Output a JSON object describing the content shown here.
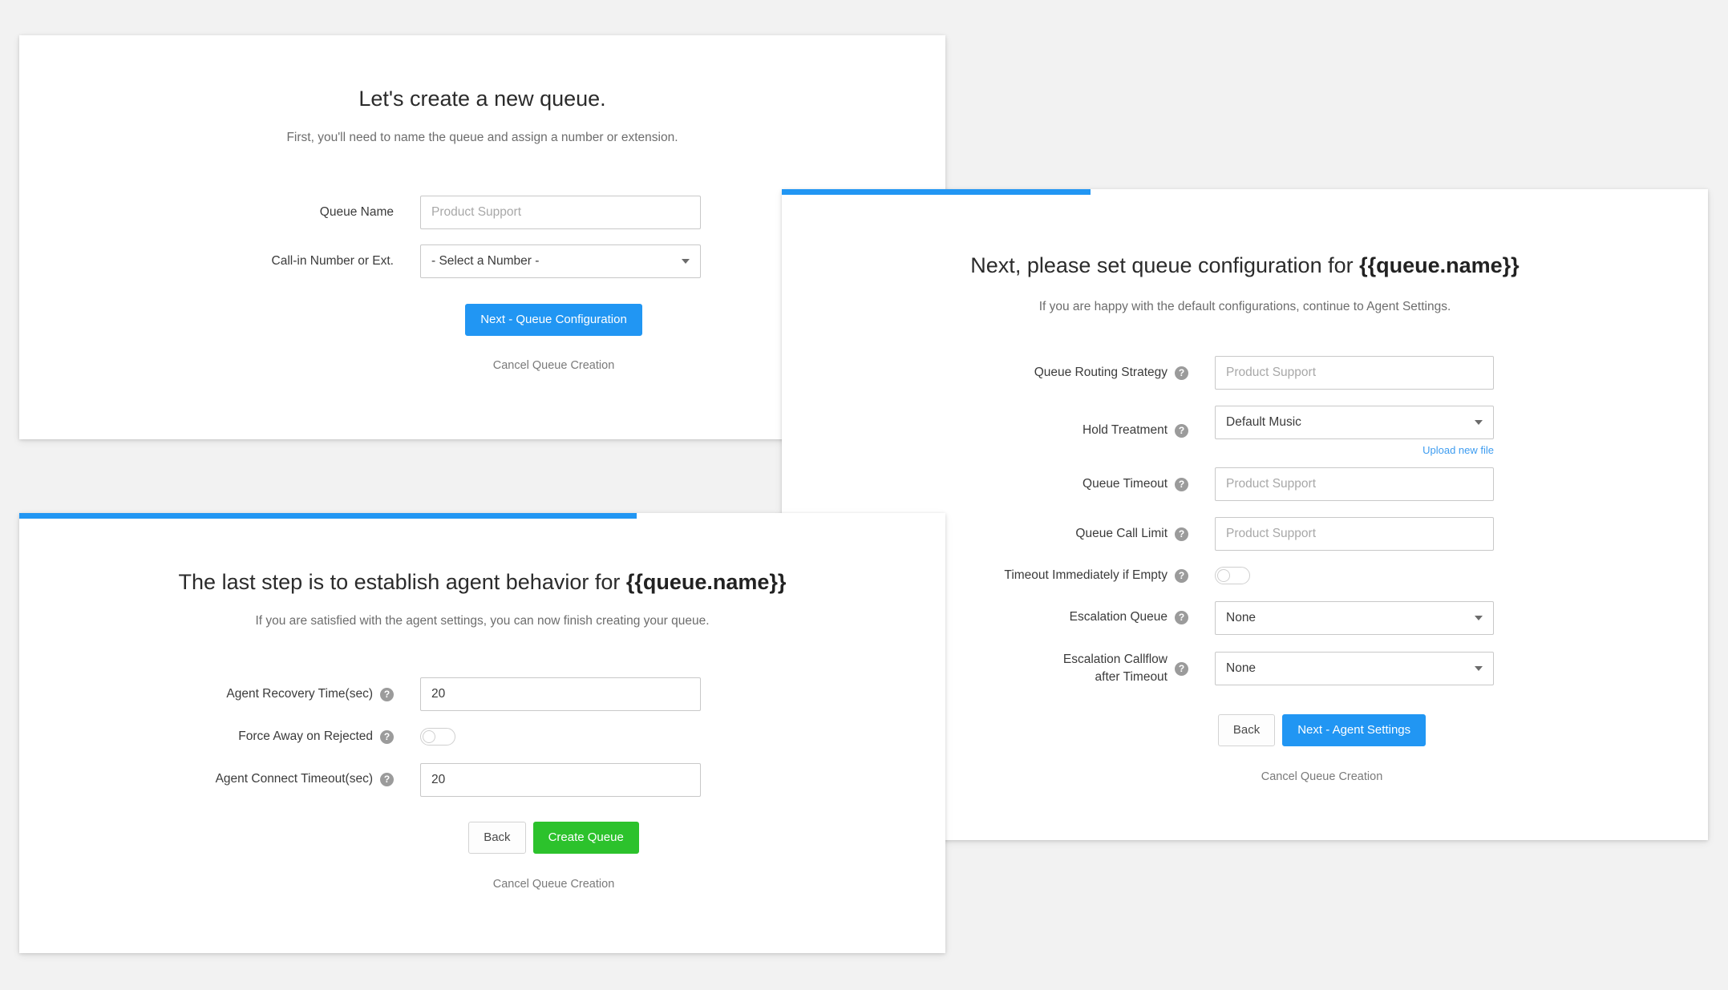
{
  "theme": {
    "page_background": "#f2f2f2",
    "card_background": "#ffffff",
    "accent_blue": "#2196f3",
    "success_green": "#2cc22c",
    "link_blue": "#3d9cf0",
    "muted_text": "#7a7a7a"
  },
  "step1": {
    "title": "Let's create a new queue.",
    "subtitle": "First, you'll need to name the queue and assign a number or extension.",
    "fields": [
      {
        "label": "Queue Name",
        "type": "text",
        "value": "",
        "placeholder": "Product Support"
      },
      {
        "label": "Call-in Number or Ext.",
        "type": "select",
        "value": "- Select a Number -"
      }
    ],
    "primary_button": "Next - Queue Configuration",
    "cancel_link": "Cancel Queue Creation"
  },
  "step2": {
    "progress_percent": 33,
    "title_prefix": "Next, please set queue configuration for ",
    "title_variable": "{{queue.name}}",
    "subtitle": "If you are happy with the default configurations, continue to Agent Settings.",
    "help_icon": "help-circle-icon",
    "fields": [
      {
        "label": "Queue Routing Strategy",
        "type": "text",
        "value": "",
        "placeholder": "Product Support",
        "help": "?"
      },
      {
        "label": "Hold Treatment",
        "type": "select",
        "value": "Default Music",
        "help": "?",
        "sub_link": "Upload new file"
      },
      {
        "label": "Queue Timeout",
        "type": "text",
        "value": "",
        "placeholder": "Product Support",
        "help": "?"
      },
      {
        "label": "Queue Call Limit",
        "type": "text",
        "value": "",
        "placeholder": "Product Support",
        "help": "?"
      },
      {
        "label": "Timeout Immediately if Empty",
        "type": "toggle",
        "value": "off",
        "help": "?"
      },
      {
        "label": "Escalation Queue",
        "type": "select",
        "value": "None",
        "help": "?"
      },
      {
        "label": "Escalation Callflow\nafter Timeout",
        "type": "select",
        "value": "None",
        "help": "?"
      }
    ],
    "back_button": "Back",
    "primary_button": "Next - Agent Settings",
    "cancel_link": "Cancel Queue Creation"
  },
  "step3": {
    "progress_percent": 66,
    "title_prefix": "The last step is to establish agent behavior for ",
    "title_variable": "{{queue.name}}",
    "subtitle": "If you are satisfied with the agent settings, you can now finish creating your queue.",
    "fields": [
      {
        "label": "Agent Recovery Time(sec)",
        "type": "text",
        "value": "20",
        "placeholder": "",
        "help": "?"
      },
      {
        "label": "Force Away on Rejected",
        "type": "toggle",
        "value": "off",
        "help": "?"
      },
      {
        "label": "Agent Connect Timeout(sec)",
        "type": "text",
        "value": "20",
        "placeholder": "",
        "help": "?"
      }
    ],
    "back_button": "Back",
    "primary_button": "Create Queue",
    "cancel_link": "Cancel Queue Creation"
  }
}
